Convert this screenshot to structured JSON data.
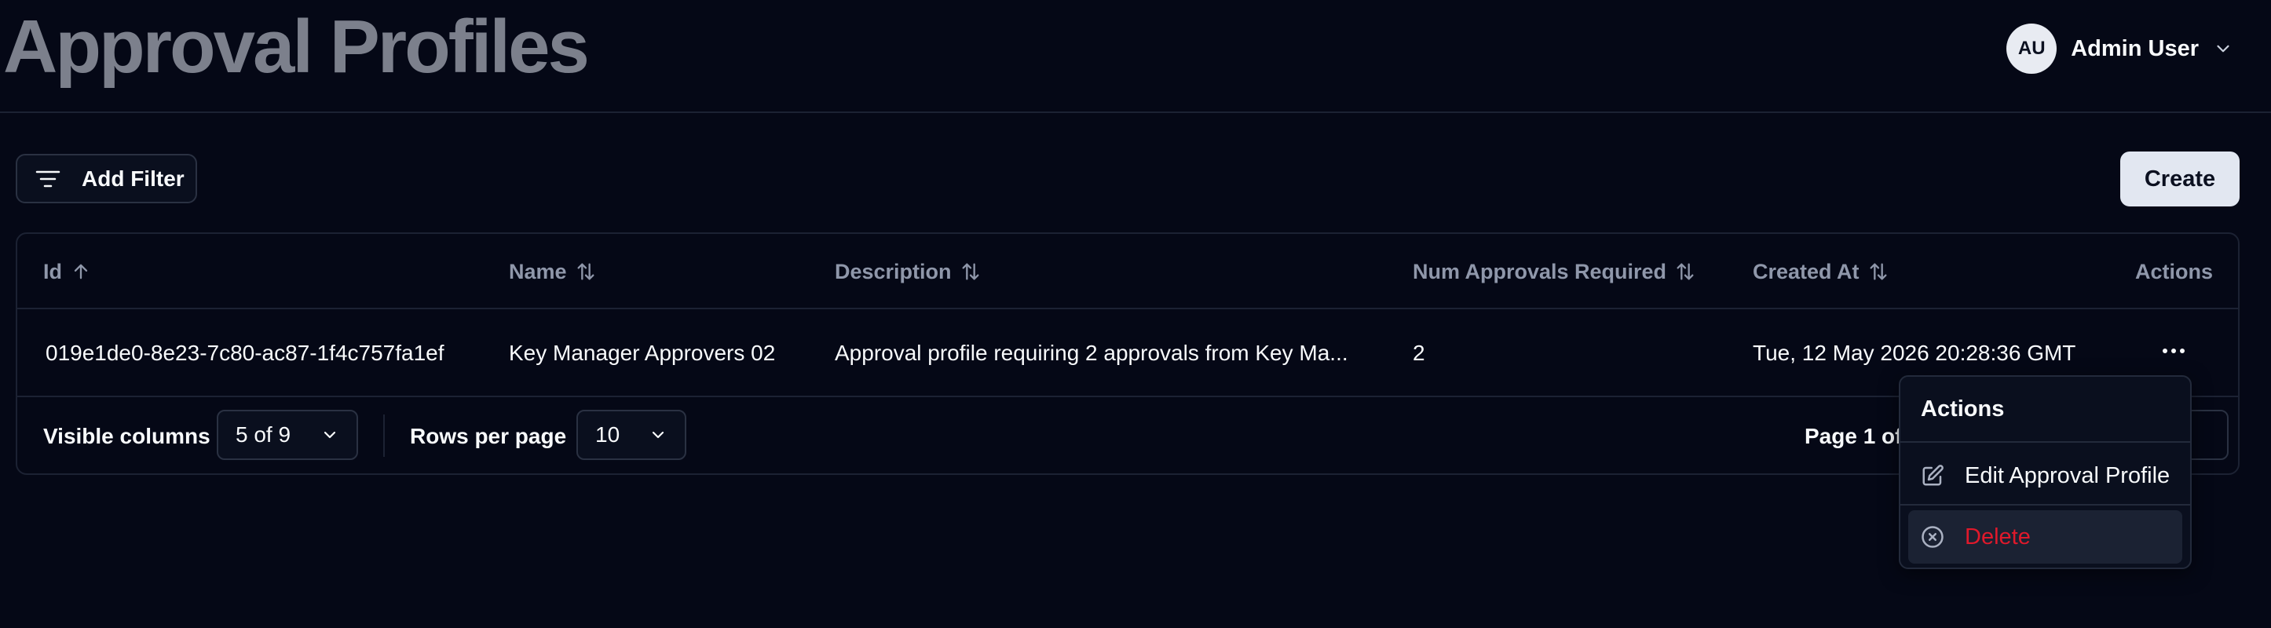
{
  "page": {
    "title": "Approval Profiles"
  },
  "user": {
    "initials": "AU",
    "name": "Admin User"
  },
  "toolbar": {
    "filter_label": "Add Filter",
    "create_label": "Create"
  },
  "table": {
    "columns": [
      {
        "label": "Id",
        "sort": "ascending"
      },
      {
        "label": "Name",
        "sort": "none"
      },
      {
        "label": "Description",
        "sort": "none"
      },
      {
        "label": "Num Approvals Required",
        "sort": "none"
      },
      {
        "label": "Created At",
        "sort": "none"
      },
      {
        "label": "Actions",
        "sort": ""
      }
    ],
    "rows": [
      {
        "id": "019e1de0-8e23-7c80-ac87-1f4c757fa1ef",
        "name": "Key Manager Approvers 02",
        "description": "Approval profile requiring 2 approvals from Key Ma...",
        "num_approvals": "2",
        "created_at": "Tue, 12 May 2026 20:28:36 GMT"
      }
    ]
  },
  "footer": {
    "visible_columns_label": "Visible columns",
    "visible_columns_value": "5 of 9",
    "rows_per_page_label": "Rows per page",
    "rows_per_page_value": "10",
    "page_info": "Page 1 of"
  },
  "actions_menu": {
    "title": "Actions",
    "items": [
      {
        "label": "Edit Approval Profile",
        "icon": "edit-icon"
      },
      {
        "label": "Delete",
        "icon": "x-circle-icon",
        "color": "#e0192b"
      }
    ]
  },
  "colors": {
    "background": "#050816",
    "accent_primary": "#e2e7f1",
    "danger": "#e0192b",
    "title_muted": "#7c808c"
  }
}
